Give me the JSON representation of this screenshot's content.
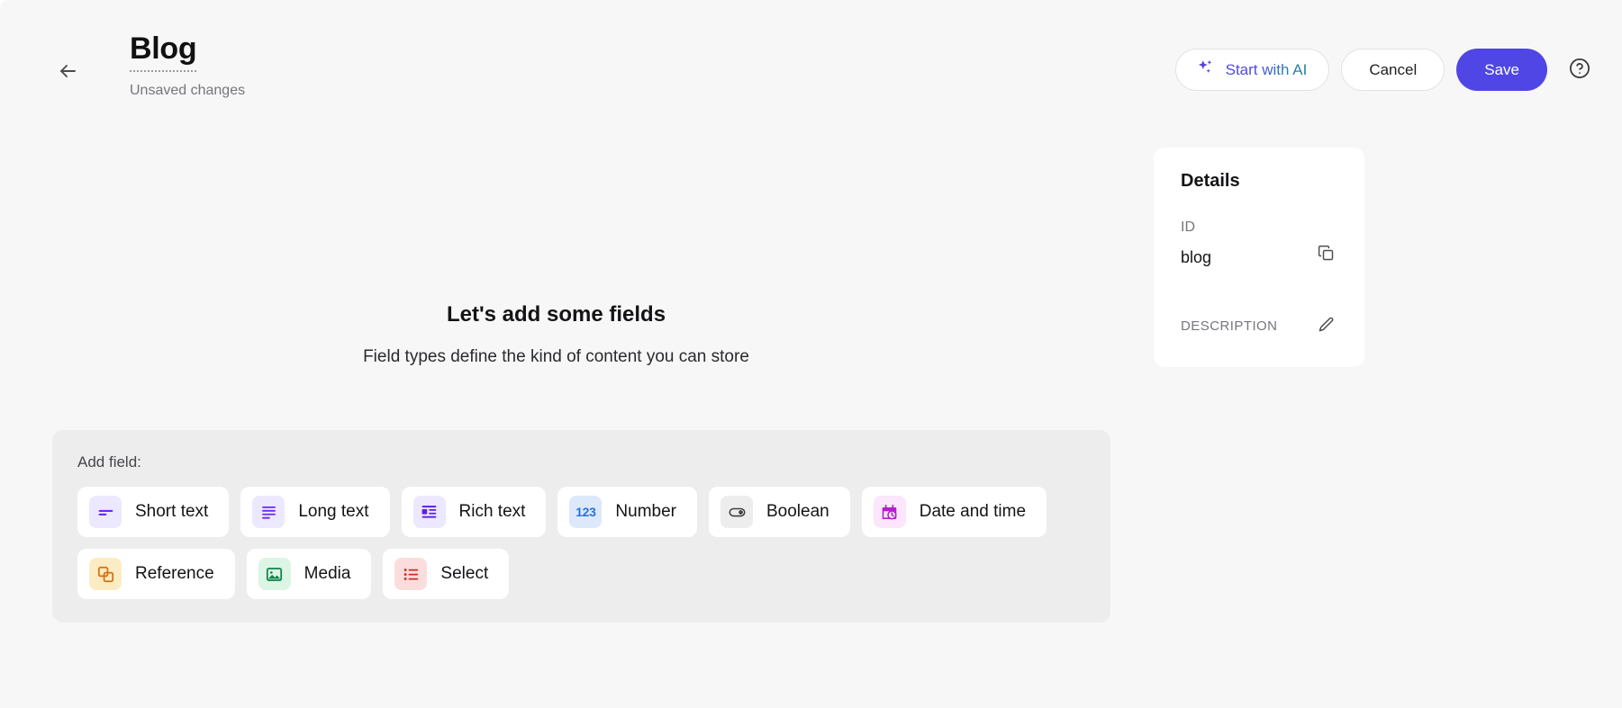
{
  "header": {
    "back_icon": "arrow-left-icon",
    "title": "Blog",
    "status": "Unsaved changes",
    "actions": {
      "ai_label": "Start with AI",
      "ai_icon": "sparkles-icon",
      "cancel_label": "Cancel",
      "save_label": "Save",
      "help_icon": "question-circle-icon"
    }
  },
  "main": {
    "empty_title": "Let's add some fields",
    "empty_subtitle": "Field types define the kind of content you can store",
    "add_field_label": "Add field:",
    "field_types": [
      {
        "label": "Short text",
        "icon": "short-text-icon",
        "fg": "#6d28f5",
        "bg": "#ece8ff"
      },
      {
        "label": "Long text",
        "icon": "long-text-icon",
        "fg": "#6d28f5",
        "bg": "#ece8ff"
      },
      {
        "label": "Rich text",
        "icon": "rich-text-icon",
        "fg": "#5b21e0",
        "bg": "#ece8ff"
      },
      {
        "label": "Number",
        "icon": "number-123-icon",
        "fg": "#2b6fe0",
        "bg": "#dce9fb",
        "glyph": "123"
      },
      {
        "label": "Boolean",
        "icon": "toggle-icon",
        "fg": "#414146",
        "bg": "#ededed"
      },
      {
        "label": "Date and time",
        "icon": "calendar-clock-icon",
        "fg": "#b021c9",
        "bg": "#fbe6fb"
      },
      {
        "label": "Reference",
        "icon": "reference-icon",
        "fg": "#d4700f",
        "bg": "#fcecc4"
      },
      {
        "label": "Media",
        "icon": "image-icon",
        "fg": "#11824a",
        "bg": "#dcf5e4"
      },
      {
        "label": "Select",
        "icon": "list-select-icon",
        "fg": "#d62626",
        "bg": "#fbdddd"
      }
    ]
  },
  "details": {
    "heading": "Details",
    "id_label": "ID",
    "id_value": "blog",
    "copy_icon": "copy-icon",
    "description_label": "DESCRIPTION",
    "edit_icon": "pencil-icon"
  },
  "colors": {
    "accent": "#4f46e5",
    "page_bg": "#f7f7f7",
    "panel_bg": "#ededed",
    "card_bg": "#ffffff",
    "text_primary": "#141417",
    "text_muted": "#75757c"
  }
}
